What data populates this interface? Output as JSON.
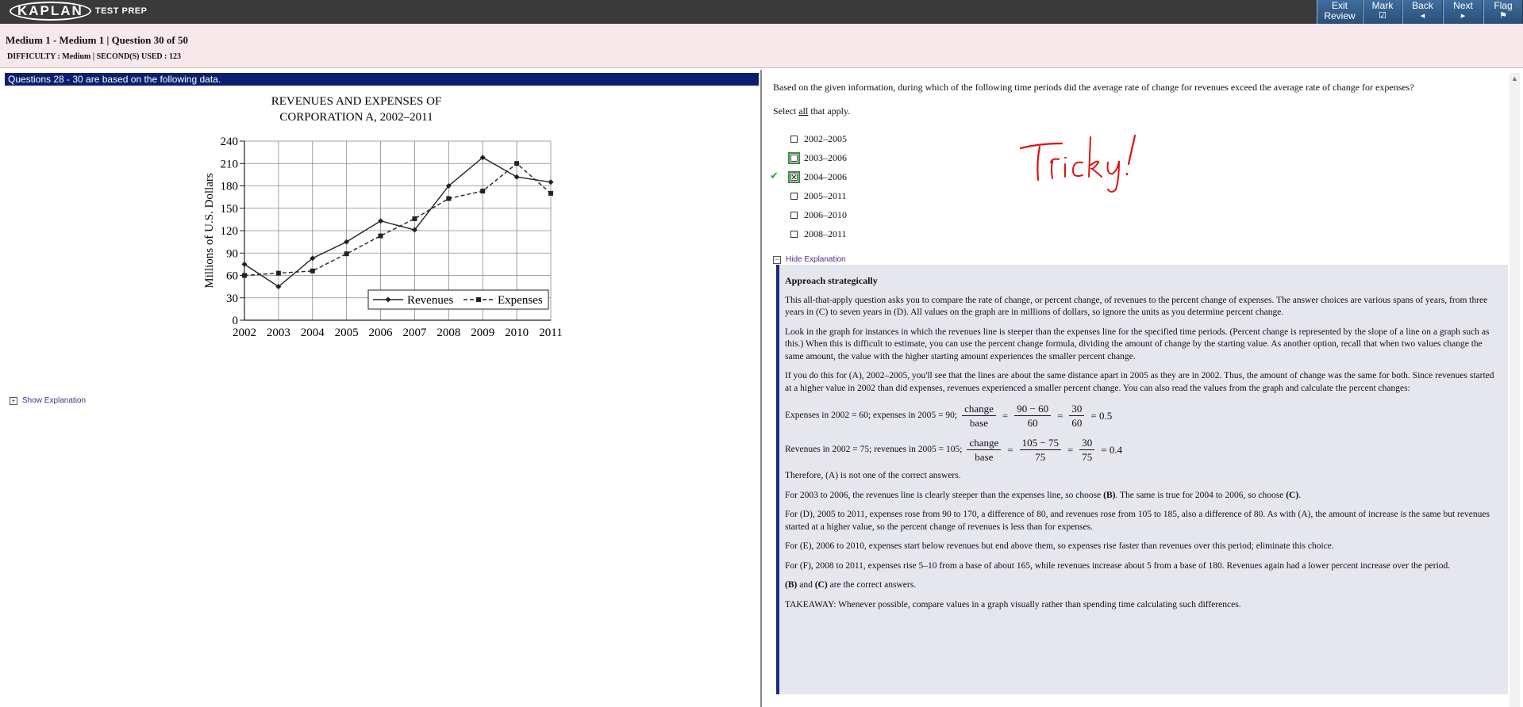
{
  "topbar": {
    "logo": "KAPLAN",
    "logo_sub": "TEST PREP",
    "buttons": [
      {
        "label": "Exit\nReview",
        "line1": "Exit",
        "line2": "Review",
        "icon": ""
      },
      {
        "label": "Mark",
        "icon": "☑"
      },
      {
        "label": "Back",
        "icon": "◂"
      },
      {
        "label": "Next",
        "icon": "▸"
      },
      {
        "label": "Flag",
        "icon": "⚑"
      }
    ]
  },
  "header": {
    "line1": "Medium 1 - Medium 1 | Question  30 of 50",
    "line2": "DIFFICULTY : Medium | SECOND(S) USED : 123"
  },
  "left": {
    "questions_bar": "Questions 28 - 30 are based on the following data.",
    "show_explanation": "Show Explanation"
  },
  "chart_data": {
    "type": "line",
    "title_line1": "REVENUES AND EXPENSES OF",
    "title_line2": "CORPORATION A, 2002–2011",
    "ylabel": "Millions of U.S. Dollars",
    "x": [
      "2002",
      "2003",
      "2004",
      "2005",
      "2006",
      "2007",
      "2008",
      "2009",
      "2010",
      "2011"
    ],
    "ylim": [
      0,
      240
    ],
    "yticks": [
      "0",
      "30",
      "60",
      "90",
      "120",
      "150",
      "180",
      "210",
      "240"
    ],
    "grid": true,
    "legend_position": "bottom-right",
    "series": [
      {
        "name": "Revenues",
        "style": "solid",
        "marker": "diamond",
        "values": [
          75,
          45,
          83,
          105,
          133,
          121,
          180,
          218,
          192,
          185
        ]
      },
      {
        "name": "Expenses",
        "style": "dashed",
        "marker": "square",
        "values": [
          60,
          63,
          66,
          89,
          113,
          136,
          163,
          173,
          210,
          170
        ]
      }
    ]
  },
  "right": {
    "question": "Based on the given information, during which of the following time periods did the average rate of change for revenues exceed the average rate of change for expenses?",
    "select_prefix": "Select ",
    "select_all": "all",
    "select_suffix": " that apply.",
    "choices": [
      {
        "label": "2002–2005",
        "checked": false,
        "highlight": false,
        "correct": false
      },
      {
        "label": "2003–2006",
        "checked": false,
        "highlight": true,
        "correct": false
      },
      {
        "label": "2004–2006",
        "checked": true,
        "highlight": true,
        "correct": true
      },
      {
        "label": "2005–2011",
        "checked": false,
        "highlight": false,
        "correct": false
      },
      {
        "label": "2006–2010",
        "checked": false,
        "highlight": false,
        "correct": false
      },
      {
        "label": "2008–2011",
        "checked": false,
        "highlight": false,
        "correct": false
      }
    ],
    "correct_mark": "✔",
    "annotation": "Tricky!",
    "hide_explanation": "Hide Explanation"
  },
  "explanation": {
    "heading": "Approach strategically",
    "p1": "This all-that-apply question asks you to compare the rate of change, or percent change, of revenues to the percent change of expenses. The answer choices are various spans of years, from three years in (C) to seven years in (D). All values on the graph are in millions of dollars, so ignore the units as you determine percent change.",
    "p2": "Look in the graph for instances in which the revenues line is steeper than the expenses line for the specified time periods. (Percent change is represented by the slope of a line on a graph such as this.) When this is difficult to estimate, you can use the percent change formula, dividing the amount of change by the starting value. As another option, recall that when two values change the same amount, the value with the higher starting amount experiences the smaller percent change.",
    "p3": "If you do this for (A), 2002–2005, you'll see that the lines are about the same distance apart in 2005 as they are in 2002. Thus, the amount of change was the same for both. Since revenues started at a higher value in 2002 than did expenses, revenues experienced a smaller percent change. You can also read the values from the graph and calculate the percent changes:",
    "eq1": {
      "lead": "Expenses in 2002 = 60; expenses in 2005 = 90;",
      "n1": "change",
      "d1": "base",
      "n2": "90 − 60",
      "d2": "60",
      "n3": "30",
      "d3": "60",
      "result": "= 0.5"
    },
    "eq2": {
      "lead": "Revenues in 2002 = 75; revenues in 2005 = 105;",
      "n1": "change",
      "d1": "base",
      "n2": "105 − 75",
      "d2": "75",
      "n3": "30",
      "d3": "75",
      "result": "= 0.4"
    },
    "p4": "Therefore, (A) is not one of the correct answers.",
    "p5a": "For 2003 to 2006, the revenues line is clearly steeper than the expenses line, so choose ",
    "p5b": "(B)",
    "p5c": ". The same is true for 2004 to 2006, so choose ",
    "p5d": "(C)",
    "p5e": ".",
    "p6": "For (D), 2005 to 2011, expenses rose from 90 to 170, a difference of 80, and revenues rose from 105 to 185, also a difference of 80. As with (A), the amount of increase is the same but revenues started at a higher value, so the percent change of revenues is less than for expenses.",
    "p7": "For (E), 2006 to 2010, expenses start below revenues but end above them, so expenses rise faster than revenues over this period; eliminate this choice.",
    "p8": "For (F), 2008 to 2011, expenses rise 5–10 from a base of about 165, while revenues increase about 5 from a base of 180. Revenues again had a lower percent increase over the period.",
    "p9a": "(B)",
    "p9b": " and ",
    "p9c": "(C)",
    "p9d": " are the correct answers.",
    "p10": "TAKEAWAY: Whenever possible, compare values in a graph visually rather than spending time calculating such differences."
  }
}
